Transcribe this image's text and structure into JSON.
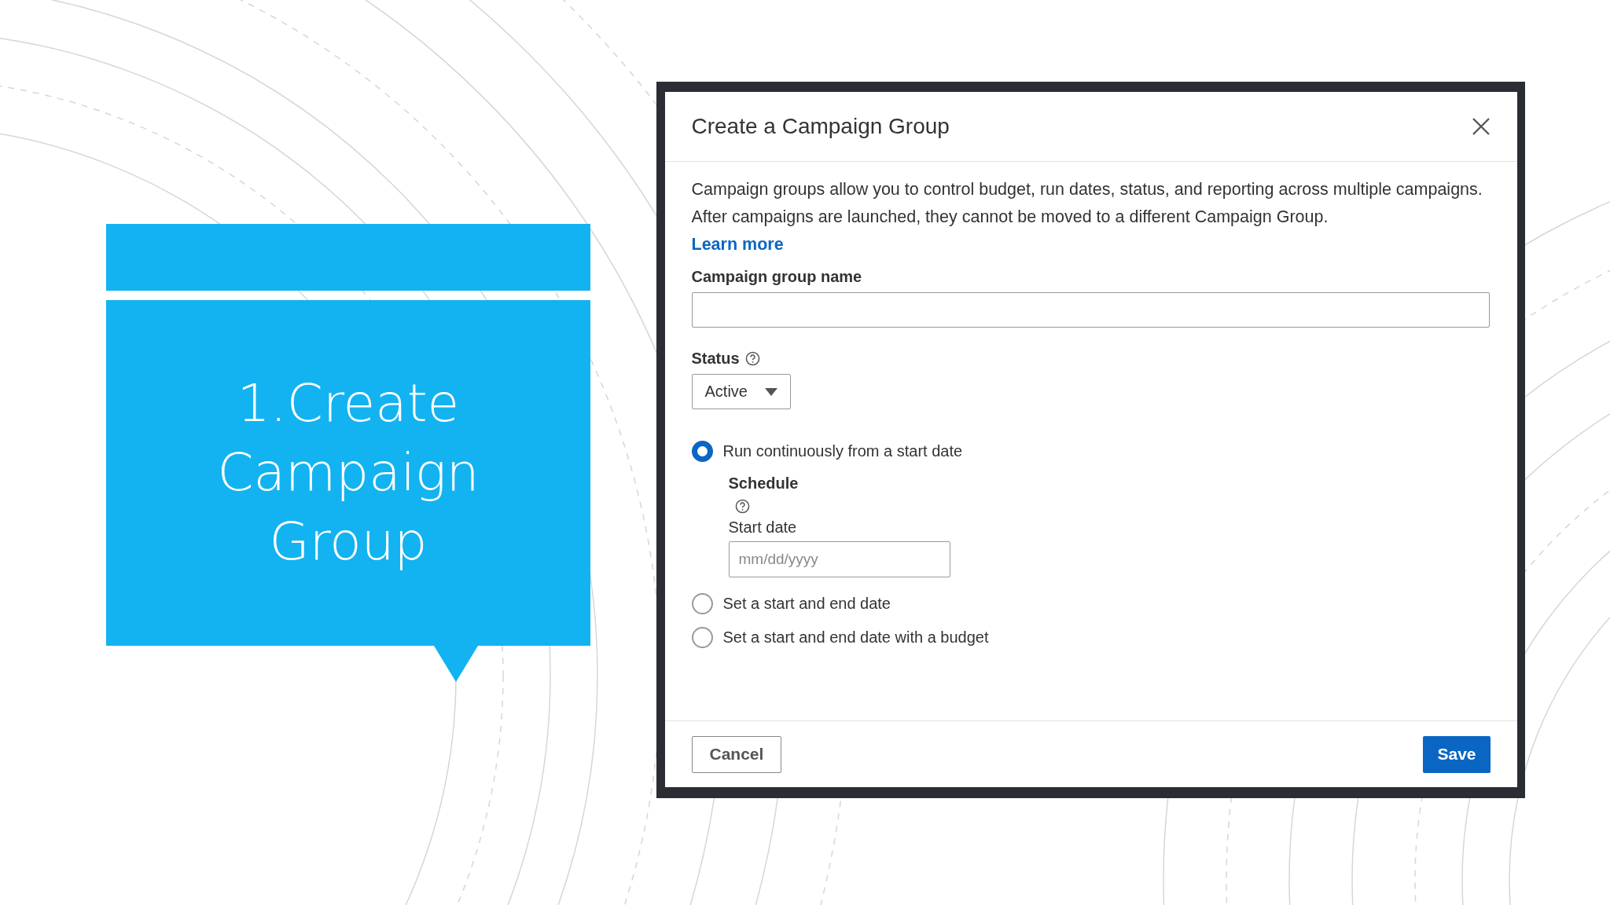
{
  "slide": {
    "title": "1.Create Campaign Group"
  },
  "dialog": {
    "title": "Create a Campaign Group",
    "description": "Campaign groups allow you to control budget, run dates, status, and reporting across multiple campaigns. After campaigns are launched, they cannot be moved to a different Campaign Group.",
    "learn_more": "Learn more",
    "name_field": {
      "label": "Campaign group name"
    },
    "status": {
      "label": "Status",
      "value": "Active"
    },
    "radios": [
      {
        "label": "Run continuously from a start date",
        "selected": true
      },
      {
        "label": "Set a start and end date",
        "selected": false
      },
      {
        "label": "Set a start and end date with a budget",
        "selected": false
      }
    ],
    "schedule": {
      "label": "Schedule",
      "start_date_label": "Start date",
      "placeholder": "mm/dd/yyyy"
    },
    "buttons": {
      "cancel": "Cancel",
      "save": "Save"
    }
  }
}
